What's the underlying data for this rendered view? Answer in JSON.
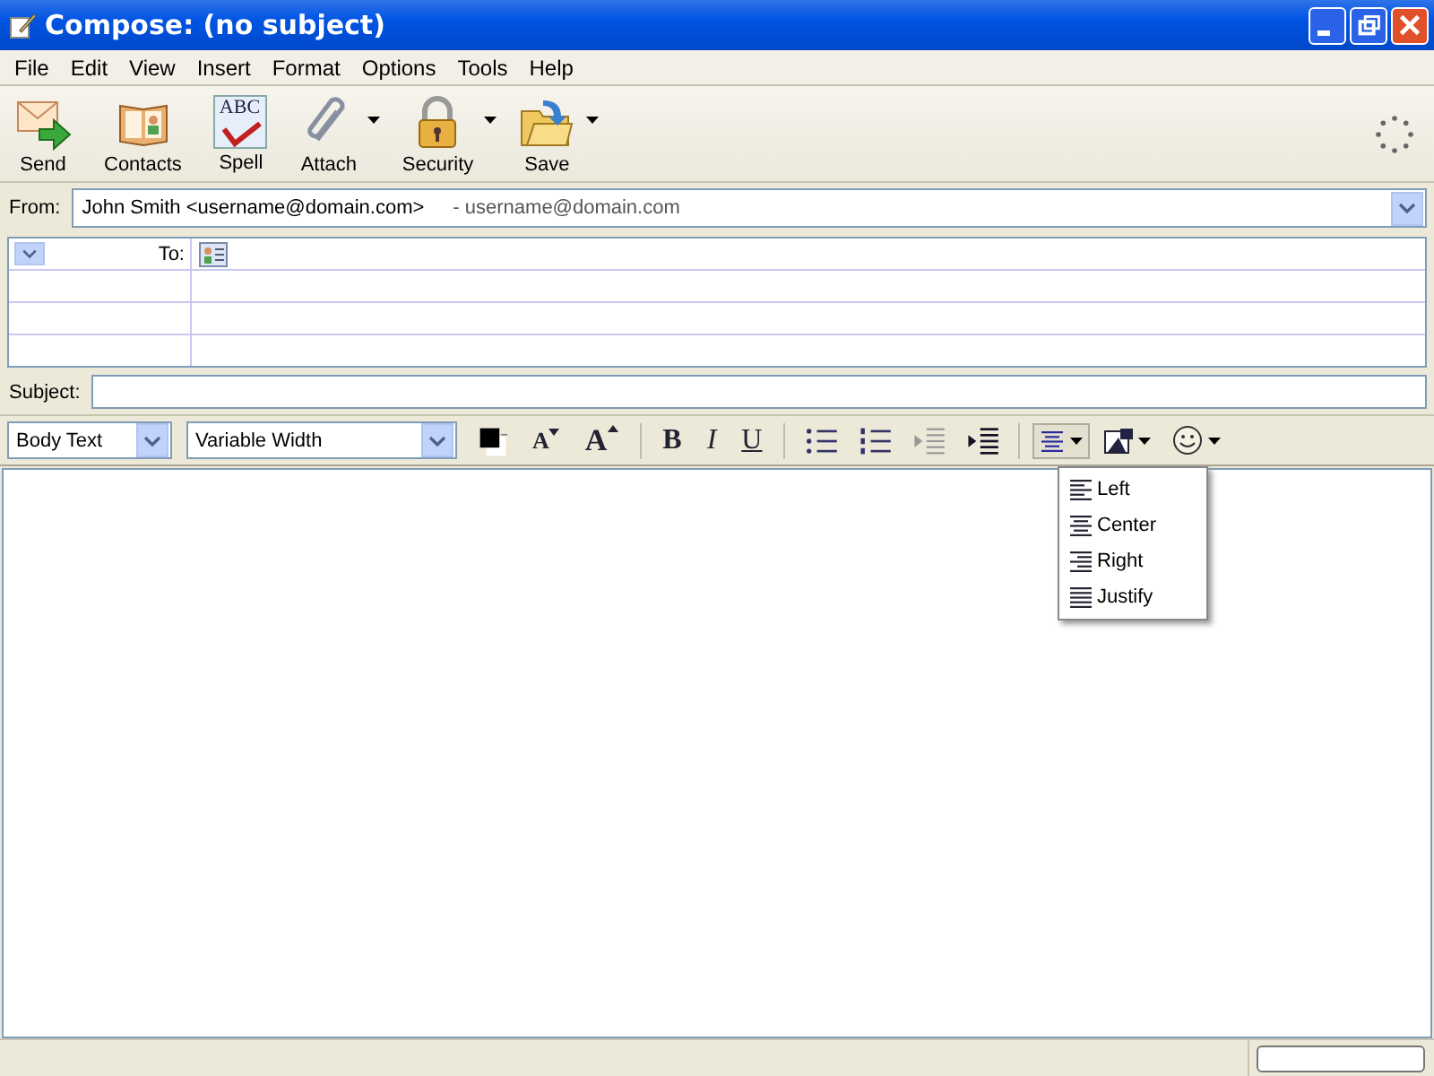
{
  "window": {
    "title": "Compose: (no subject)"
  },
  "menu_bar": [
    "File",
    "Edit",
    "View",
    "Insert",
    "Format",
    "Options",
    "Tools",
    "Help"
  ],
  "toolbar": [
    {
      "kind": "send",
      "label": "Send",
      "has_menu": false
    },
    {
      "kind": "contacts",
      "label": "Contacts",
      "has_menu": false
    },
    {
      "kind": "spell",
      "label": "Spell",
      "has_menu": false,
      "icon_text": "ABC"
    },
    {
      "kind": "attach",
      "label": "Attach",
      "has_menu": true
    },
    {
      "kind": "security",
      "label": "Security",
      "has_menu": true
    },
    {
      "kind": "save",
      "label": "Save",
      "has_menu": true
    }
  ],
  "from": {
    "label": "From:",
    "value": "John Smith <username@domain.com>",
    "account": "- username@domain.com"
  },
  "recipients": [
    {
      "type": "To:"
    }
  ],
  "subject": {
    "label": "Subject:"
  },
  "format_bar": {
    "paragraph": "Body Text",
    "font": "Variable Width",
    "buttons": [
      {
        "kind": "smaller",
        "label": "A"
      },
      {
        "kind": "larger",
        "label": "A"
      },
      {
        "kind": "bold",
        "label": "B"
      },
      {
        "kind": "italic",
        "label": "I"
      },
      {
        "kind": "underline",
        "label": "U"
      }
    ]
  },
  "align_menu": {
    "expanded": true,
    "items": [
      {
        "kind": "left",
        "label": "Left"
      },
      {
        "kind": "center",
        "label": "Center"
      },
      {
        "kind": "right",
        "label": "Right"
      },
      {
        "kind": "justify",
        "label": "Justify"
      }
    ]
  }
}
